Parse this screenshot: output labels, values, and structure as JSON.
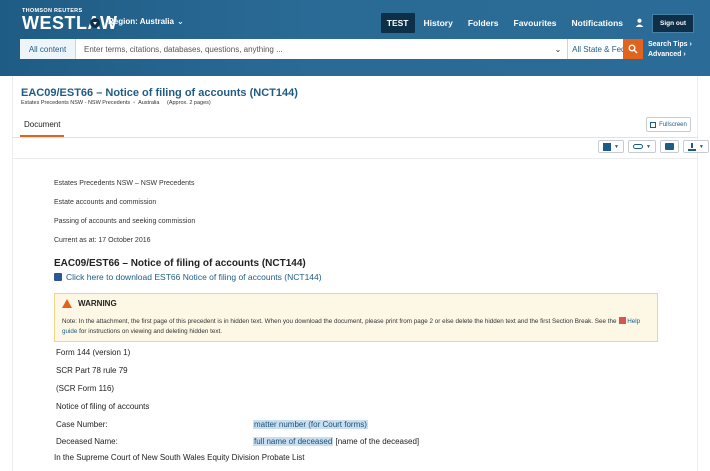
{
  "header": {
    "brand_top": "THOMSON REUTERS",
    "brand": "WESTLAW",
    "region": "Region: Australia",
    "nav": [
      "TEST",
      "History",
      "Folders",
      "Favourites",
      "Notifications"
    ],
    "signout": "Sign out"
  },
  "search": {
    "scope": "All content",
    "placeholder": "Enter terms, citations, databases, questions, anything ...",
    "jurisdiction": "All State & Federal",
    "tips": "Search Tips ›",
    "advanced": "Advanced ›"
  },
  "document": {
    "title": "EAC09/EST66 – Notice of filing of accounts (NCT144)",
    "meta": [
      "Estates Precedents NSW - NSW Precedents",
      "Australia",
      "(Approx. 2 pages)"
    ],
    "tab": "Document",
    "fullscreen": "Fullscreen"
  },
  "content": {
    "lines": [
      "Estates Precedents NSW – NSW Precedents",
      "Estate accounts and commission",
      "Passing of accounts and seeking commission",
      "Current as at: 17 October 2016"
    ],
    "section_title": "EAC09/EST66 – Notice of filing of accounts (NCT144)",
    "download_link": "Click here to download EST66 Notice of filing of accounts (NCT144)",
    "warning": {
      "title": "WARNING",
      "text_before": "Note: In the attachment, the first page of this precedent is in hidden text. When you download the document, please print from page 2 or else delete the hidden text and the first Section Break. See the ",
      "help_link": "Help guide",
      "text_after": " for instructions on viewing and deleting hidden text."
    },
    "form_lines": [
      "Form 144 (version 1)",
      "SCR Part 78 rule 79",
      "(SCR Form 116)",
      "Notice of filing of accounts"
    ],
    "fields": [
      {
        "label": "Case Number:",
        "value": "matter number (for Court forms)",
        "suffix": ""
      },
      {
        "label": "Deceased Name:",
        "value": "full name of deceased",
        "suffix": " [name of the deceased]"
      }
    ],
    "footer": "In the Supreme Court of New South Wales Equity Division Probate List"
  },
  "colors": {
    "header_blue": "#2a6c97",
    "accent_orange": "#e2631c",
    "link_blue": "#1f5c85",
    "warning_bg": "#fdf8e6",
    "highlight": "#c9dff1"
  }
}
